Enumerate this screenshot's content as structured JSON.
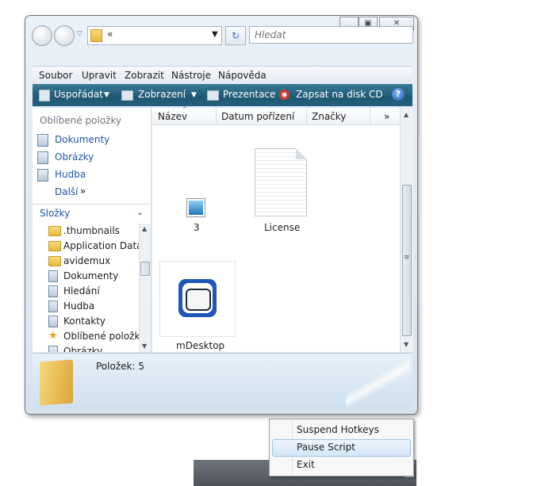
{
  "window": {
    "address_text": "«",
    "search_placeholder": "Hledat"
  },
  "menubar": [
    "Soubor",
    "Upravit",
    "Zobrazit",
    "Nástroje",
    "Nápověda"
  ],
  "commandbar": {
    "organize": "Uspořádat",
    "views": "Zobrazení",
    "slideshow": "Prezentace",
    "burn": "Zapsat na disk CD"
  },
  "navpane": {
    "favorites_header": "Oblíbené položky",
    "favorites": [
      "Dokumenty",
      "Obrázky",
      "Hudba"
    ],
    "more": "Další",
    "more_arrow": "»",
    "folders_header": "Složky",
    "folders": [
      ".thumbnails",
      "Application Data",
      "avidemux",
      "Dokumenty",
      "Hledání",
      "Hudba",
      "Kontakty",
      "Oblíbené položky",
      "Obrázky"
    ]
  },
  "columns": [
    "Název",
    "Datum pořízení",
    "Značky",
    "»"
  ],
  "files": [
    {
      "name": "3"
    },
    {
      "name": "License"
    },
    {
      "name": "mDesktop"
    }
  ],
  "details": {
    "count": "Položek: 5"
  },
  "context_menu": [
    "Suspend Hotkeys",
    "Pause Script",
    "Exit"
  ],
  "colors": {
    "accent": "#1f5873",
    "selection": "#dbe8f5"
  }
}
